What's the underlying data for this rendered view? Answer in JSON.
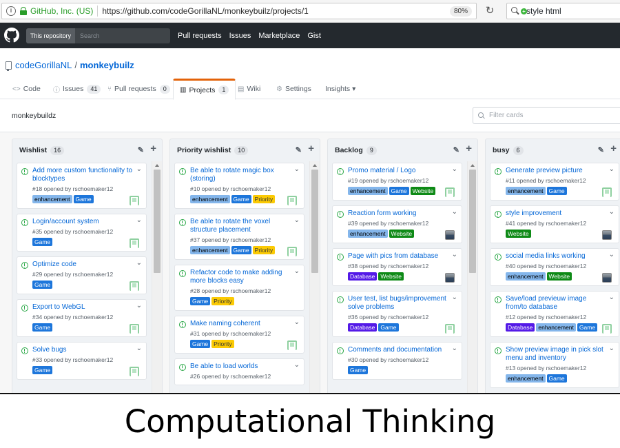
{
  "browser": {
    "identity": "GitHub, Inc. (US)",
    "url": "https://github.com/codeGorillaNL/monkeybuilz/projects/1",
    "zoom": "80%",
    "search_text": "style html"
  },
  "header": {
    "scope": "This repository",
    "search_placeholder": "Search",
    "nav": [
      "Pull requests",
      "Issues",
      "Marketplace",
      "Gist"
    ]
  },
  "repo": {
    "owner": "codeGorillaNL",
    "separator": "/",
    "name": "monkeybuilz"
  },
  "tabs": [
    {
      "label": "Code",
      "icon": "code-icon",
      "count": ""
    },
    {
      "label": "Issues",
      "icon": "issue-icon",
      "count": "41"
    },
    {
      "label": "Pull requests",
      "icon": "pull-request-icon",
      "count": "0"
    },
    {
      "label": "Projects",
      "icon": "project-icon",
      "count": "1"
    },
    {
      "label": "Wiki",
      "icon": "book-icon",
      "count": ""
    },
    {
      "label": "Settings",
      "icon": "gear-icon",
      "count": ""
    },
    {
      "label": "Insights ▾",
      "icon": "",
      "count": ""
    }
  ],
  "project": {
    "name": "monkeybuildz",
    "filter_placeholder": "Filter cards"
  },
  "label_colors": {
    "enhancement": "#84b6eb",
    "Game": "#1d76db",
    "Priority": "#fbca04",
    "Website": "#0e8a16",
    "Database": "#5319e7"
  },
  "columns": [
    {
      "title": "Wishlist",
      "count": "16",
      "cards": [
        {
          "title": "Add more custom functionality to blocktypes",
          "meta": "#18 opened by rschoemaker12",
          "labels": [
            "enhancement",
            "Game"
          ],
          "avatar": "green"
        },
        {
          "title": "Login/account system",
          "meta": "#35 opened by rschoemaker12",
          "labels": [
            "Game"
          ],
          "avatar": "green"
        },
        {
          "title": "Optimize code",
          "meta": "#29 opened by rschoemaker12",
          "labels": [
            "Game"
          ],
          "avatar": "green"
        },
        {
          "title": "Export to WebGL",
          "meta": "#34 opened by rschoemaker12",
          "labels": [
            "Game"
          ],
          "avatar": "green"
        },
        {
          "title": "Solve bugs",
          "meta": "#33 opened by rschoemaker12",
          "labels": [
            "Game"
          ],
          "avatar": "green"
        }
      ]
    },
    {
      "title": "Priority wishlist",
      "count": "10",
      "cards": [
        {
          "title": "Be able to rotate magic box (storing)",
          "meta": "#10 opened by rschoemaker12",
          "labels": [
            "enhancement",
            "Game",
            "Priority"
          ],
          "avatar": "green"
        },
        {
          "title": "Be able to rotate the voxel structure placement",
          "meta": "#37 opened by rschoemaker12",
          "labels": [
            "enhancement",
            "Game",
            "Priority"
          ],
          "avatar": "green"
        },
        {
          "title": "Refactor code to make adding more blocks easy",
          "meta": "#28 opened by rschoemaker12",
          "labels": [
            "Game",
            "Priority"
          ],
          "avatar": ""
        },
        {
          "title": "Make naming coherent",
          "meta": "#31 opened by rschoemaker12",
          "labels": [
            "Game",
            "Priority"
          ],
          "avatar": "green"
        },
        {
          "title": "Be able to load worlds",
          "meta": "#26 opened by rschoemaker12",
          "labels": [],
          "avatar": ""
        }
      ]
    },
    {
      "title": "Backlog",
      "count": "9",
      "cards": [
        {
          "title": "Promo material / Logo",
          "meta": "#19 opened by rschoemaker12",
          "labels": [
            "enhancement",
            "Game",
            "Website"
          ],
          "avatar": "green"
        },
        {
          "title": "Reaction form working",
          "meta": "#39 opened by rschoemaker12",
          "labels": [
            "enhancement",
            "Website"
          ],
          "avatar": "photo"
        },
        {
          "title": "Page with pics from database",
          "meta": "#38 opened by rschoemaker12",
          "labels": [
            "Database",
            "Website"
          ],
          "avatar": "photo"
        },
        {
          "title": "User test, list bugs/improvement solve problems",
          "meta": "#36 opened by rschoemaker12",
          "labels": [
            "Database",
            "Game"
          ],
          "avatar": "green"
        },
        {
          "title": "Comments and documentation",
          "meta": "#30 opened by rschoemaker12",
          "labels": [
            "Game"
          ],
          "avatar": ""
        }
      ]
    },
    {
      "title": "busy",
      "count": "6",
      "cards": [
        {
          "title": "Generate preview picture",
          "meta": "#11 opened by rschoemaker12",
          "labels": [
            "enhancement",
            "Game"
          ],
          "avatar": "green"
        },
        {
          "title": "style improvement",
          "meta": "#41 opened by rschoemaker12",
          "labels": [
            "Website"
          ],
          "avatar": "photo"
        },
        {
          "title": "social media links working",
          "meta": "#40 opened by rschoemaker12",
          "labels": [
            "enhancement",
            "Website"
          ],
          "avatar": "photo"
        },
        {
          "title": "Save/load previeuw image from/to database",
          "meta": "#12 opened by rschoemaker12",
          "labels": [
            "Database",
            "enhancement",
            "Game"
          ],
          "avatar": "green"
        },
        {
          "title": "Show preview image in pick slot menu and inventory",
          "meta": "#13 opened by rschoemaker12",
          "labels": [
            "enhancement",
            "Game"
          ],
          "avatar": ""
        }
      ]
    }
  ],
  "caption": "Computational Thinking"
}
